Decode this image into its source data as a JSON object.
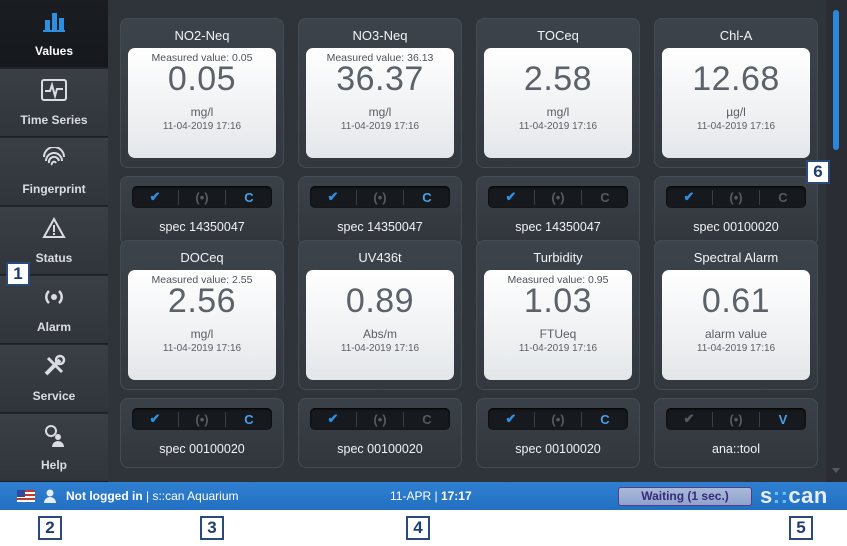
{
  "sidebar": {
    "items": [
      {
        "label": "Values",
        "icon": "bar-chart-icon"
      },
      {
        "label": "Time Series",
        "icon": "waveform-icon"
      },
      {
        "label": "Fingerprint",
        "icon": "fingerprint-icon"
      },
      {
        "label": "Status",
        "icon": "warning-triangle-icon"
      },
      {
        "label": "Alarm",
        "icon": "broadcast-icon"
      },
      {
        "label": "Service",
        "icon": "tools-icon"
      },
      {
        "label": "Help",
        "icon": "help-person-icon"
      }
    ],
    "active": "Values"
  },
  "tiles": [
    {
      "title": "NO2-Neq",
      "measured": "Measured value: 0.05",
      "value": "0.05",
      "unit": "mg/l",
      "timestamp": "11-04-2019 17:16",
      "status": [
        "on",
        "off",
        "on"
      ],
      "status_last": "C",
      "spec": "spec 14350047"
    },
    {
      "title": "NO3-Neq",
      "measured": "Measured value: 36.13",
      "value": "36.37",
      "unit": "mg/l",
      "timestamp": "11-04-2019 17:16",
      "status": [
        "on",
        "off",
        "on"
      ],
      "status_last": "C",
      "spec": "spec 14350047"
    },
    {
      "title": "TOCeq",
      "measured": "",
      "value": "2.58",
      "unit": "mg/l",
      "timestamp": "11-04-2019 17:16",
      "status": [
        "on",
        "off",
        "off"
      ],
      "status_last": "C",
      "spec": "spec 14350047"
    },
    {
      "title": "Chl-A",
      "measured": "",
      "value": "12.68",
      "unit": "µg/l",
      "timestamp": "11-04-2019 17:16",
      "status": [
        "on",
        "off",
        "off"
      ],
      "status_last": "C",
      "spec": "spec 00100020"
    },
    {
      "title": "DOCeq",
      "measured": "Measured value: 2.55",
      "value": "2.56",
      "unit": "mg/l",
      "timestamp": "11-04-2019 17:16",
      "status": [
        "on",
        "off",
        "on"
      ],
      "status_last": "C",
      "spec": "spec 00100020"
    },
    {
      "title": "UV436t",
      "measured": "",
      "value": "0.89",
      "unit": "Abs/m",
      "timestamp": "11-04-2019 17:16",
      "status": [
        "on",
        "off",
        "off"
      ],
      "status_last": "C",
      "spec": "spec 00100020"
    },
    {
      "title": "Turbidity",
      "measured": "Measured value: 0.95",
      "value": "1.03",
      "unit": "FTUeq",
      "timestamp": "11-04-2019 17:16",
      "status": [
        "on",
        "off",
        "on"
      ],
      "status_last": "C",
      "spec": "spec 00100020"
    },
    {
      "title": "Spectral Alarm",
      "measured": "",
      "value": "0.61",
      "unit": "alarm value",
      "timestamp": "11-04-2019 17:16",
      "status": [
        "off",
        "off",
        "on"
      ],
      "status_last": "V",
      "spec": "ana::tool"
    }
  ],
  "statusbar": {
    "login_status": "Not logged in",
    "separator": " | ",
    "station": "s::can Aquarium",
    "date": "11-APR",
    "date_sep": " | ",
    "time": "17:17",
    "waiting": "Waiting (1 sec.)",
    "logo_prefix": "s",
    "logo_dots": "::",
    "logo_suffix": "can"
  },
  "callouts": {
    "c1": "1",
    "c2": "2",
    "c3": "3",
    "c4": "4",
    "c5": "5",
    "c6": "6"
  },
  "colors": {
    "accent": "#2f8fe0",
    "statusbar": "#2676c6",
    "background": "#2f343b"
  }
}
